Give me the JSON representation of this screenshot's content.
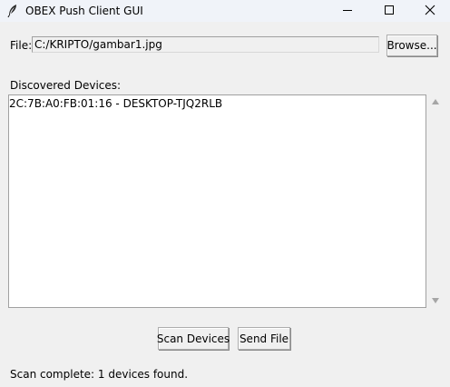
{
  "window": {
    "title": "OBEX Push Client GUI",
    "icon": "feather-icon",
    "controls": [
      "minimize-icon",
      "maximize-icon",
      "close-icon"
    ]
  },
  "file": {
    "label": "File:",
    "value": "C:/KRIPTO/gambar1.jpg",
    "browse_label": "Browse..."
  },
  "devices": {
    "label": "Discovered Devices:",
    "items": [
      "2C:7B:A0:FB:01:16  -  DESKTOP-TJQ2RLB"
    ]
  },
  "actions": {
    "scan_label": "Scan Devices",
    "send_label": "Send File"
  },
  "status": {
    "text": "Scan complete: 1 devices found."
  },
  "colors": {
    "background": "#f0f0f0",
    "titlebar": "#f0f3f9",
    "list_background": "#ffffff",
    "border": "#a0a0a0"
  }
}
